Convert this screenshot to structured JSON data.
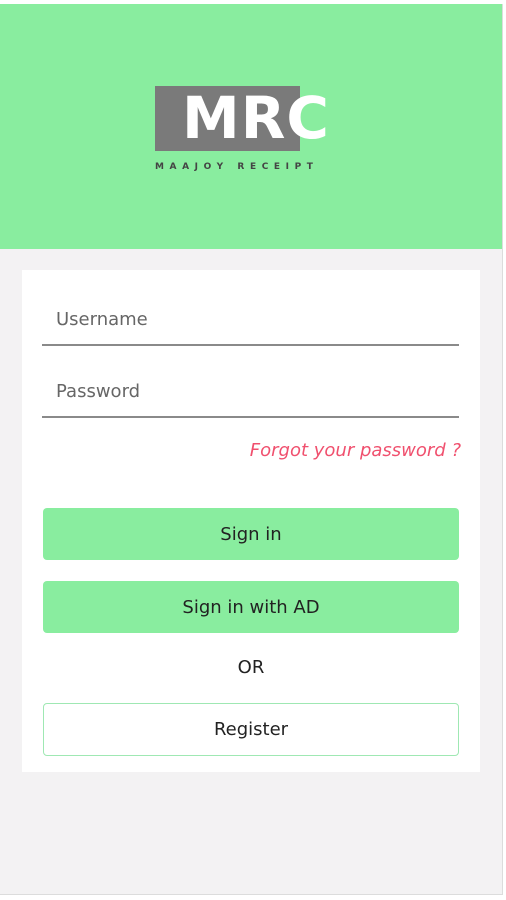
{
  "header": {
    "logo_text": "MRC",
    "logo_subtitle": "MAAJOY RECEIPT",
    "brand_color": "#89ed9f"
  },
  "login": {
    "username_placeholder": "Username",
    "password_placeholder": "Password",
    "forgot_link": "Forgot your password ?",
    "signin_label": "Sign in",
    "signin_ad_label": "Sign in with AD",
    "or_label": "OR",
    "register_label": "Register",
    "accent_link_color": "#f0506e"
  }
}
